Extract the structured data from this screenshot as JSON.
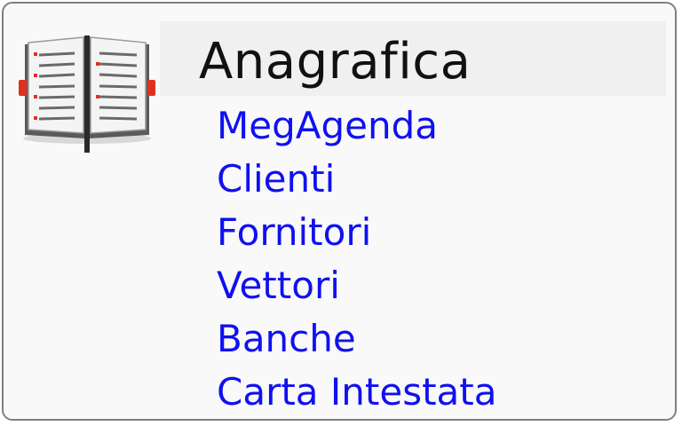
{
  "section": {
    "title": "Anagrafica",
    "icon": "open-book-icon"
  },
  "menu": {
    "items": [
      {
        "label": "MegAgenda"
      },
      {
        "label": "Clienti"
      },
      {
        "label": "Fornitori"
      },
      {
        "label": "Vettori"
      },
      {
        "label": "Banche"
      },
      {
        "label": "Carta Intestata"
      }
    ]
  },
  "colors": {
    "link": "#1010f0",
    "title": "#111111",
    "panel_bg": "#f9f9f9",
    "title_band_bg": "#f0f0f0",
    "border": "#7f7f7f",
    "bookmark": "#e03020"
  }
}
